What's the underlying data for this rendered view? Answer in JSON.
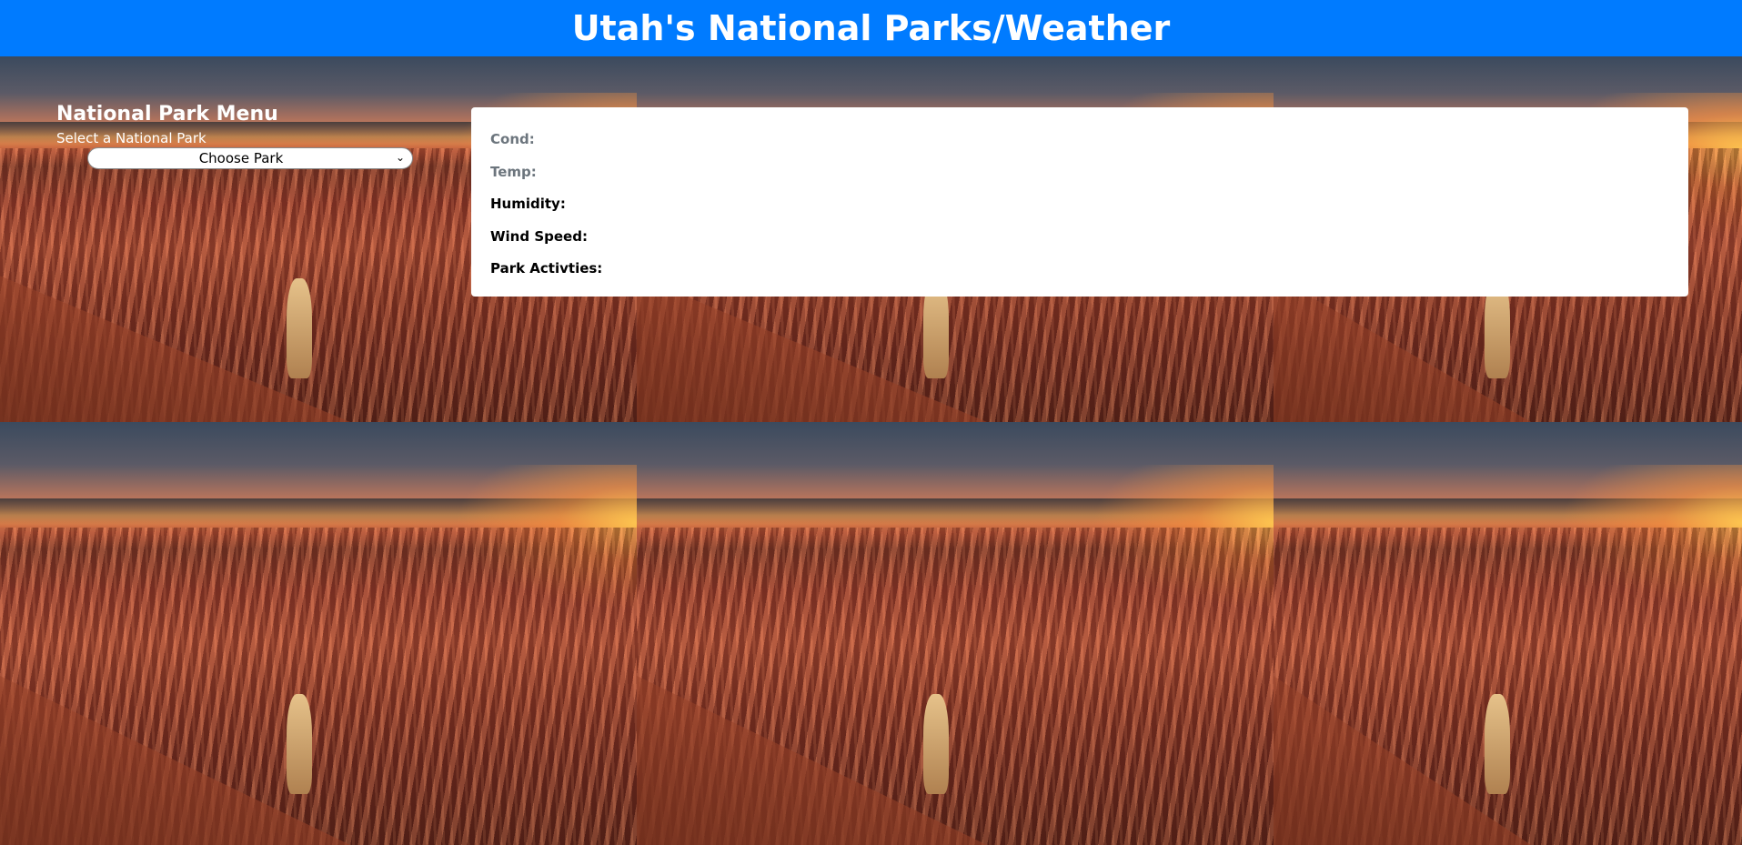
{
  "header": {
    "title": "Utah's National Parks/Weather"
  },
  "menu": {
    "title": "National Park Menu",
    "select_label": "Select a National Park",
    "select_value": "Choose Park"
  },
  "weather": {
    "cond_label": "Cond:",
    "temp_label": "Temp:",
    "humidity_label": "Humidity:",
    "wind_label": "Wind Speed:",
    "activities_label": "Park Activties:"
  },
  "colors": {
    "header_bg": "#007bff",
    "muted_label": "#6c757d"
  }
}
